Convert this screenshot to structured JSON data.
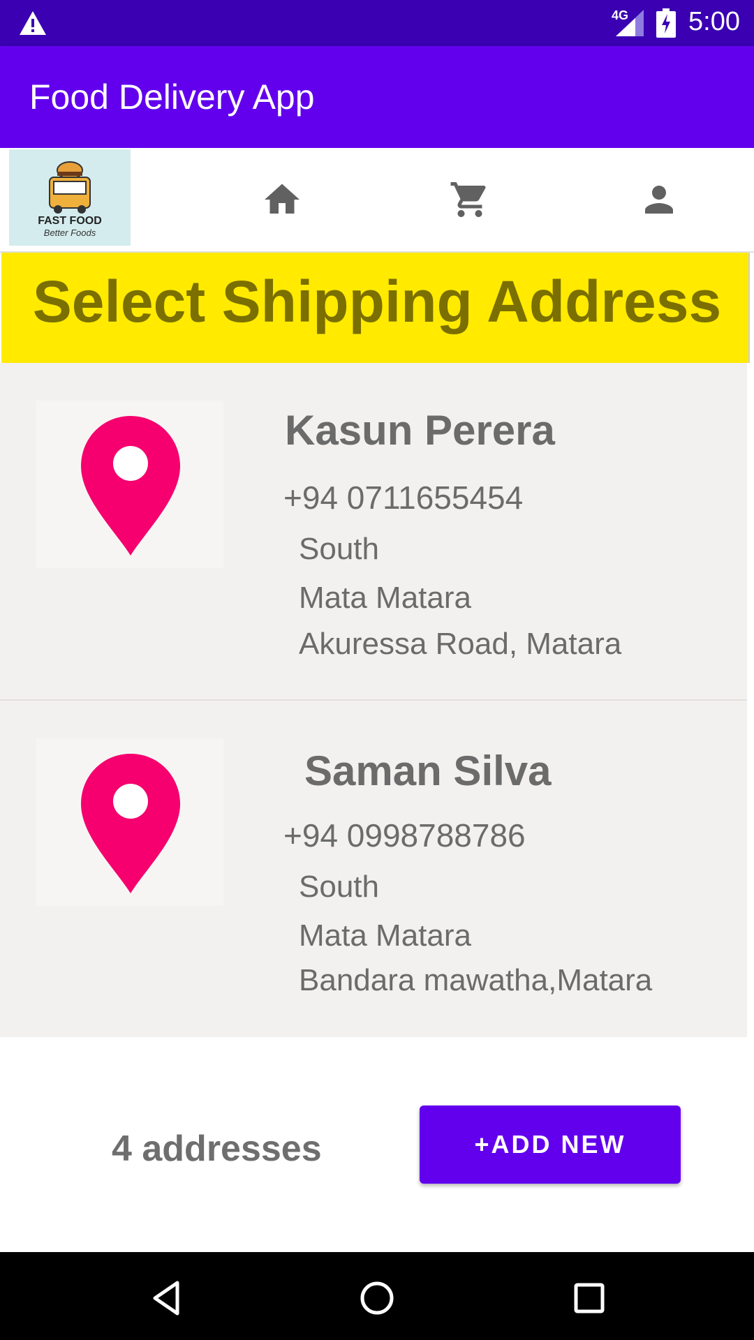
{
  "status_bar": {
    "network_label": "4G",
    "time": "5:00",
    "icons": [
      "warning-icon",
      "cell-signal-icon",
      "battery-charging-icon"
    ]
  },
  "app_bar": {
    "title": "Food Delivery App"
  },
  "nav": {
    "logo": {
      "line1": "FAST FOOD",
      "line2": "Better Foods"
    },
    "icons": [
      "home-icon",
      "cart-icon",
      "profile-icon"
    ]
  },
  "banner": {
    "title": "Select Shipping Address"
  },
  "addresses": [
    {
      "name": "Kasun Perera",
      "phone": "+94  0711655454",
      "line1": "South",
      "line2": "Mata Matara",
      "line3": "Akuressa Road, Matara"
    },
    {
      "name": "Saman Silva",
      "phone": "+94  0998788786",
      "line1": "South",
      "line2": "Mata Matara",
      "line3": "Bandara mawatha,Matara"
    }
  ],
  "footer": {
    "count_label": "4 addresses",
    "add_button": "+ADD NEW"
  },
  "colors": {
    "status_bar": "#3a00b2",
    "primary": "#6200ee",
    "banner_bg": "#ffea00",
    "banner_text": "#7a6f00",
    "pin": "#f5006e",
    "card_bg": "#f3f1ef"
  }
}
